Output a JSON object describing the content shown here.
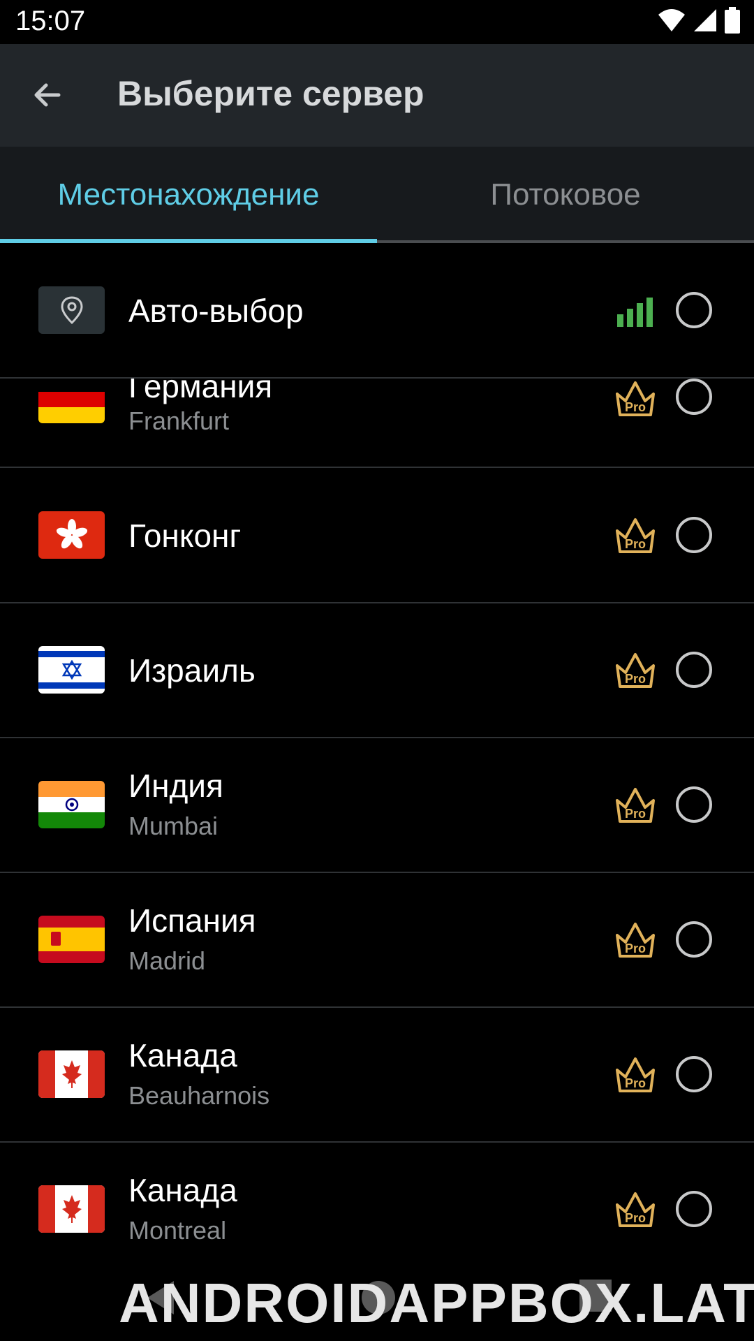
{
  "status_bar": {
    "time": "15:07"
  },
  "app_bar": {
    "title": "Выберите сервер"
  },
  "tabs": [
    {
      "label": "Местонахождение",
      "active": true
    },
    {
      "label": "Потоковое",
      "active": false
    }
  ],
  "auto_select": {
    "label": "Авто-выбор"
  },
  "servers": [
    {
      "country": "Германия",
      "city": "Frankfurt",
      "flag": "germany-flag",
      "badge": "Pro"
    },
    {
      "country": "Гонконг",
      "city": "",
      "flag": "hong-kong-flag",
      "badge": "Pro"
    },
    {
      "country": "Израиль",
      "city": "",
      "flag": "israel-flag",
      "badge": "Pro"
    },
    {
      "country": "Индия",
      "city": "Mumbai",
      "flag": "india-flag",
      "badge": "Pro"
    },
    {
      "country": "Испания",
      "city": "Madrid",
      "flag": "spain-flag",
      "badge": "Pro"
    },
    {
      "country": "Канада",
      "city": "Beauharnois",
      "flag": "canada-flag",
      "badge": "Pro"
    },
    {
      "country": "Канада",
      "city": "Montreal",
      "flag": "canada-flag",
      "badge": "Pro"
    }
  ],
  "watermark": "ANDROIDAPPBOX.LAT",
  "colors": {
    "accent": "#5fcde6",
    "pro_gold": "#e1b25a",
    "signal_green": "#4caf50",
    "app_bar": "#22262a",
    "tabs_bg": "#171a1d"
  }
}
